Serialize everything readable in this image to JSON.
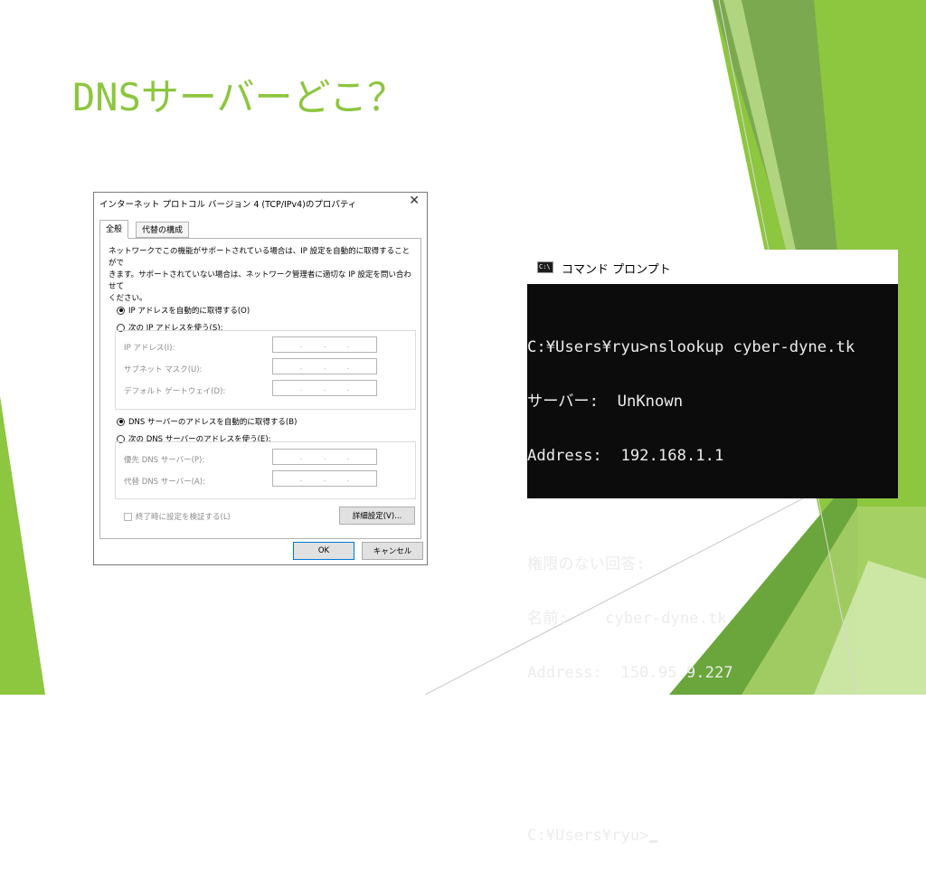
{
  "slide": {
    "title": "DNSサーバーどこ？",
    "accent_color": "#8dc63f"
  },
  "dialog": {
    "title": "インターネット プロトコル バージョン 4 (TCP/IPv4)のプロパティ",
    "close_icon": "close-icon",
    "tabs": [
      {
        "label": "全般"
      },
      {
        "label": "代替の構成"
      }
    ],
    "description_line1": "ネットワークでこの機能がサポートされている場合は、IP 設定を自動的に取得することがで",
    "description_line2": "きます。サポートされていない場合は、ネットワーク管理者に適切な IP 設定を問い合わせて",
    "description_line3": "ください。",
    "ip_auto_label": "IP アドレスを自動的に取得する(O)",
    "ip_manual_label": "次の IP アドレスを使う(S):",
    "ip_address_label": "IP アドレス(I):",
    "subnet_label": "サブネット マスク(U):",
    "gateway_label": "デフォルト ゲートウェイ(D):",
    "dns_auto_label": "DNS サーバーのアドレスを自動的に取得する(B)",
    "dns_manual_label": "次の DNS サーバーのアドレスを使う(E):",
    "preferred_dns_label": "優先 DNS サーバー(P):",
    "alternate_dns_label": "代替 DNS サーバー(A):",
    "validate_label": "終了時に設定を検証する(L)",
    "advanced_button": "詳細設定(V)...",
    "ok_button": "OK",
    "cancel_button": "キャンセル",
    "ip_dots": "."
  },
  "cmd": {
    "title": "コマンド プロンプト",
    "icon_text": "C:\\",
    "lines": [
      "C:¥Users¥ryu>nslookup cyber-dyne.tk",
      "サーバー:  UnKnown",
      "Address:  192.168.1.1",
      "",
      "権限のない回答:",
      "名前:    cyber-dyne.tk",
      "Address:  150.95.9.227",
      "",
      "",
      "C:¥Users¥ryu>"
    ]
  }
}
